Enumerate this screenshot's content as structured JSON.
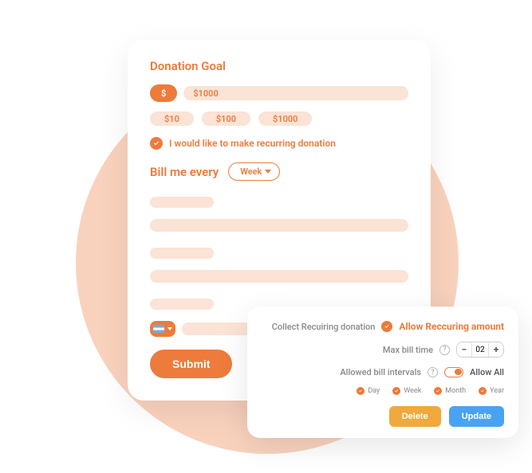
{
  "donation": {
    "title": "Donation Goal",
    "currency_symbol": "$",
    "goal_amount": "$1000",
    "amount_options": [
      "$10",
      "$100",
      "$1000"
    ],
    "recurring_label": "I would like to make recurring donation",
    "bill_label": "Bill me every",
    "bill_interval": "Week",
    "submit_label": "Submit"
  },
  "settings": {
    "collect_label": "Collect Recuiring donation",
    "allow_recurring_label": "Allow Reccuring amount",
    "max_bill_label": "Max bill time",
    "max_bill_value": "02",
    "allowed_intervals_label": "Allowed bill intervals",
    "allow_all_label": "Allow All",
    "intervals": [
      "Day",
      "Week",
      "Month",
      "Year"
    ],
    "delete_label": "Delete",
    "update_label": "Update"
  }
}
